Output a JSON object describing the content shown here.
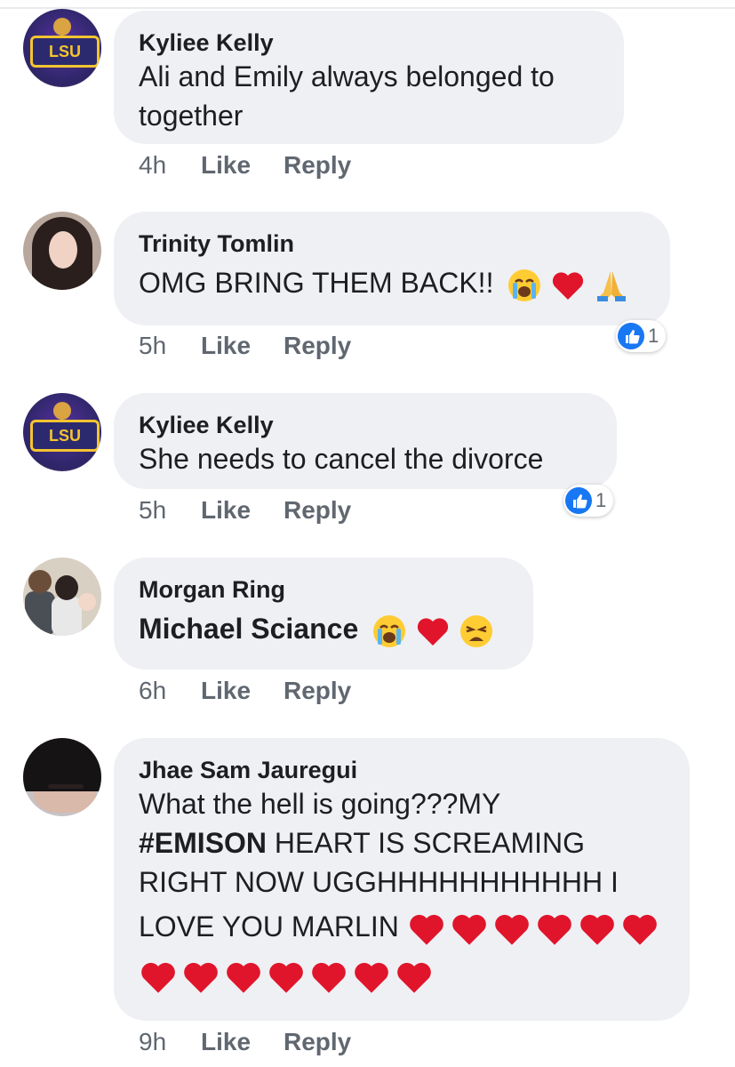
{
  "comments": [
    {
      "author": "Kyliee Kelly",
      "avatar_alt": "LSU Tigers logo",
      "lines": [
        "Ali and Emily always belonged to",
        "together"
      ],
      "time": "4h",
      "like_label": "Like",
      "reply_label": "Reply"
    },
    {
      "author": "Trinity Tomlin",
      "text": "OMG BRING THEM BACK!!",
      "emojis": [
        "loudly-crying-face",
        "red-heart",
        "folded-hands"
      ],
      "time": "5h",
      "like_label": "Like",
      "reply_label": "Reply",
      "reaction_count": "1"
    },
    {
      "author": "Kyliee Kelly",
      "text": "She needs to cancel the divorce",
      "time": "5h",
      "like_label": "Like",
      "reply_label": "Reply",
      "reaction_count": "1"
    },
    {
      "author": "Morgan Ring",
      "text": "Michael Sciance",
      "emojis": [
        "loudly-crying-face",
        "red-heart",
        "weary-face"
      ],
      "time": "6h",
      "like_label": "Like",
      "reply_label": "Reply"
    },
    {
      "author": "Jhae Sam Jauregui",
      "line1": "What the hell is going???MY",
      "hashtag": "#EMISON",
      "line2_rest": " HEART IS SCREAMING",
      "line3": "RIGHT NOW UGGHHHHHHHHHHH I",
      "line4": "LOVE YOU MARLIN",
      "hearts_line4": 6,
      "hearts_line5": 7,
      "time": "9h",
      "like_label": "Like",
      "reply_label": "Reply"
    }
  ],
  "colors": {
    "bubble": "#eff0f3",
    "text": "#1c1e21",
    "meta": "#606770",
    "like_blue": "#1877f2",
    "heart_red": "#e0152b"
  }
}
